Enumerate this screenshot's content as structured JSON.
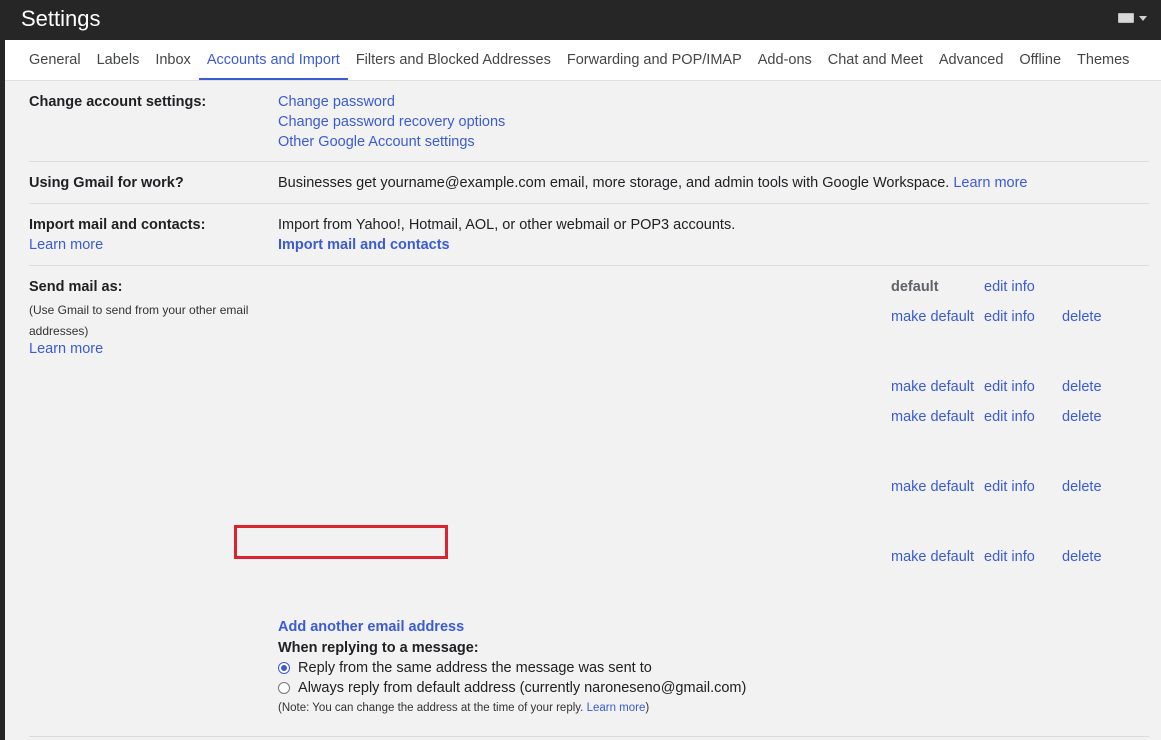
{
  "header": {
    "title": "Settings",
    "keyboard_icon": "keyboard-icon"
  },
  "tabs": [
    {
      "label": "General"
    },
    {
      "label": "Labels"
    },
    {
      "label": "Inbox"
    },
    {
      "label": "Accounts and Import",
      "active": true
    },
    {
      "label": "Filters and Blocked Addresses"
    },
    {
      "label": "Forwarding and POP/IMAP"
    },
    {
      "label": "Add-ons"
    },
    {
      "label": "Chat and Meet"
    },
    {
      "label": "Advanced"
    },
    {
      "label": "Offline"
    },
    {
      "label": "Themes"
    }
  ],
  "change_account": {
    "label": "Change account settings:",
    "links": [
      "Change password",
      "Change password recovery options",
      "Other Google Account settings"
    ]
  },
  "gmail_work": {
    "label": "Using Gmail for work?",
    "text": "Businesses get yourname@example.com email, more storage, and admin tools with Google Workspace.",
    "link": "Learn more"
  },
  "import_mail": {
    "label": "Import mail and contacts:",
    "learn_more": "Learn more",
    "text": "Import from Yahoo!, Hotmail, AOL, or other webmail or POP3 accounts.",
    "action": "Import mail and contacts"
  },
  "send_mail_as": {
    "label": "Send mail as:",
    "note": "(Use Gmail to send from your other email addresses)",
    "learn_more": "Learn more",
    "first_row": {
      "default": "default",
      "edit": "edit info"
    },
    "rows_actions": {
      "make_default": "make default",
      "edit": "edit info",
      "delete": "delete"
    },
    "add_address": "Add another email address",
    "reply_heading": "When replying to a message:",
    "reply_options": [
      {
        "label": "Reply from the same address the message was sent to",
        "selected": true
      },
      {
        "label": "Always reply from default address (currently naroneseno@gmail.com)",
        "selected": false
      }
    ],
    "reply_note_prefix": "(Note: You can change the address at the time of your reply.",
    "reply_note_link": "Learn more",
    "reply_note_suffix": ")"
  },
  "colors": {
    "link": "#3b5bd6",
    "highlight": "#d9232f",
    "topbar": "#262626"
  }
}
